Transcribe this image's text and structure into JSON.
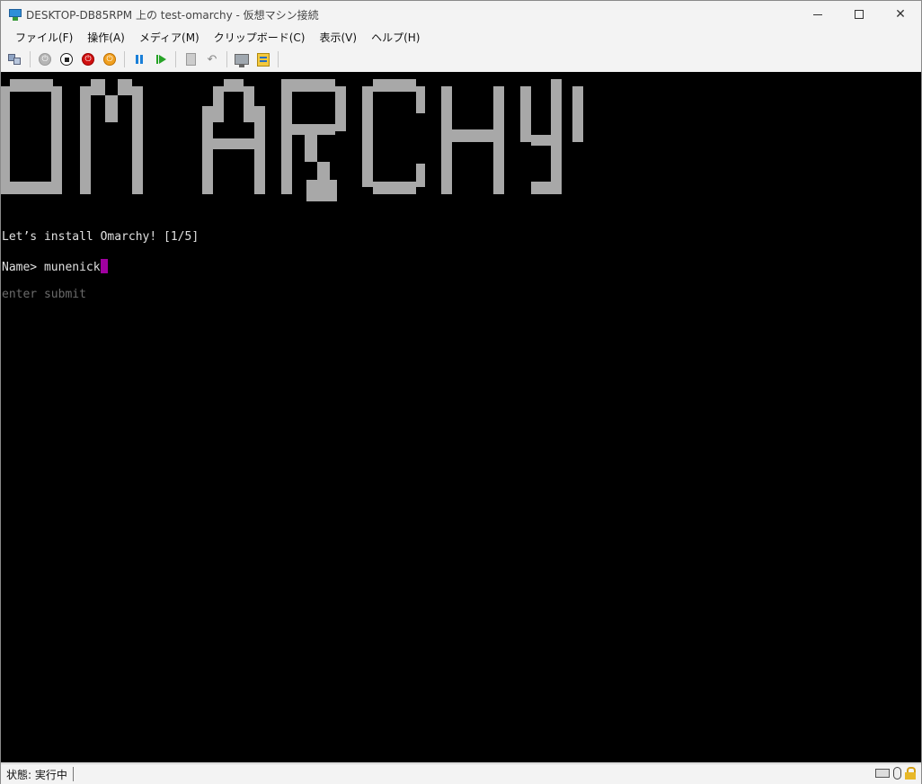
{
  "window": {
    "title": "DESKTOP-DB85RPM 上の test-omarchy - 仮想マシン接続",
    "controls": {
      "minimize": "",
      "maximize": "",
      "close": "✕"
    }
  },
  "menu": [
    "ファイル(F)",
    "操作(A)",
    "メディア(M)",
    "クリップボード(C)",
    "表示(V)",
    "ヘルプ(H)"
  ],
  "toolbar": {
    "icons": [
      "ctrl-alt-del-icon",
      "start-icon",
      "turn-off-icon",
      "shutdown-icon",
      "save-icon",
      "pause-icon",
      "resume-icon",
      "checkpoint-icon",
      "revert-icon",
      "enhanced-session-icon",
      "settings-icon"
    ]
  },
  "console": {
    "logo_text": "OMARCHY",
    "prompt_title": "Let’s install Omarchy! [1/5]",
    "name_label": "Name> ",
    "name_value": "munenick",
    "hint": "enter submit",
    "colors": {
      "background": "#000000",
      "logo": "#a8a8a8",
      "text": "#e0e0e0",
      "hint": "#6b6b6b",
      "cursor": "#a000a0"
    }
  },
  "status": {
    "text": "状態: 実行中"
  }
}
